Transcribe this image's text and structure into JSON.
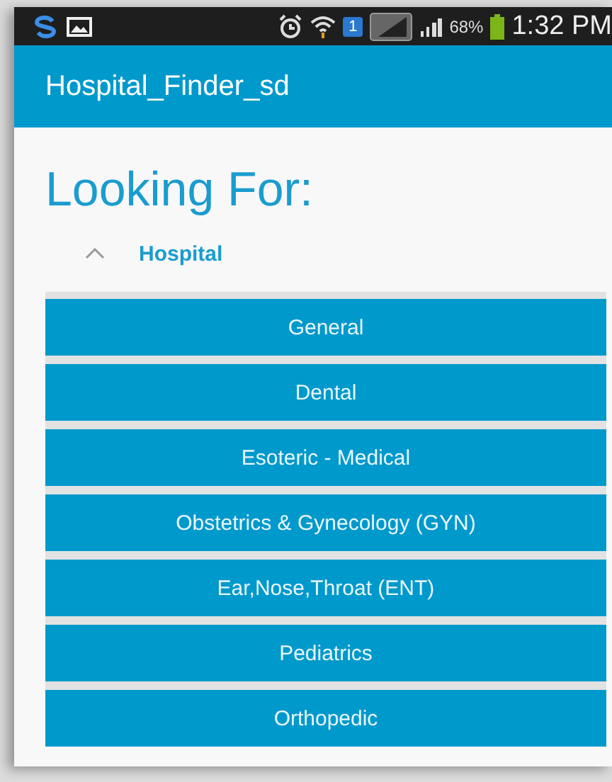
{
  "status_bar": {
    "sim_badge": "1",
    "battery_percent": "68%",
    "time": "1:32 PM"
  },
  "app_bar": {
    "title": "Hospital_Finder_sd"
  },
  "heading": "Looking For:",
  "group": {
    "label": "Hospital",
    "expanded": true,
    "items": [
      {
        "label": "General"
      },
      {
        "label": "Dental"
      },
      {
        "label": "Esoteric - Medical"
      },
      {
        "label": "Obstetrics & Gynecology (GYN)"
      },
      {
        "label": "Ear,Nose,Throat (ENT)"
      },
      {
        "label": "Pediatrics"
      },
      {
        "label": "Orthopedic"
      }
    ]
  }
}
